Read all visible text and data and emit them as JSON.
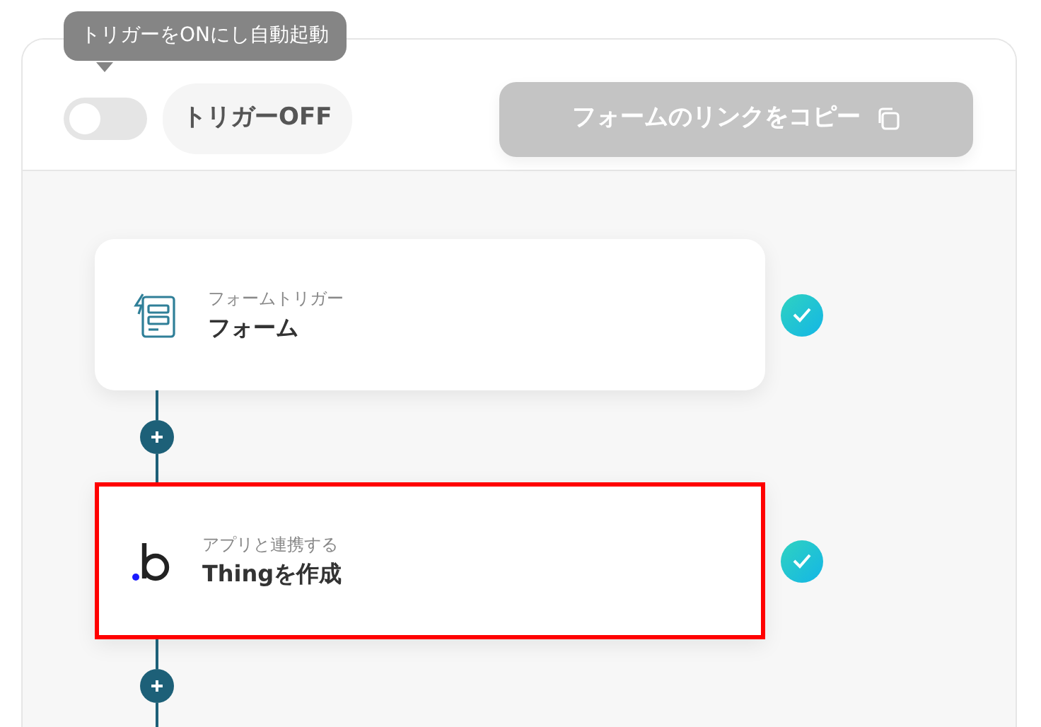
{
  "tooltip": {
    "text": "トリガーをONにし自動起動"
  },
  "trigger_toggle": {
    "on": false,
    "label": "トリガーOFF"
  },
  "copy_button": {
    "label": "フォームのリンクをコピー",
    "disabled": true
  },
  "steps": [
    {
      "kind": "form",
      "caption": "フォームトリガー",
      "title": "フォーム",
      "done": true,
      "highlighted": false
    },
    {
      "kind": "app",
      "caption": "アプリと連携する",
      "title": "Thingを作成",
      "done": true,
      "highlighted": true
    }
  ]
}
